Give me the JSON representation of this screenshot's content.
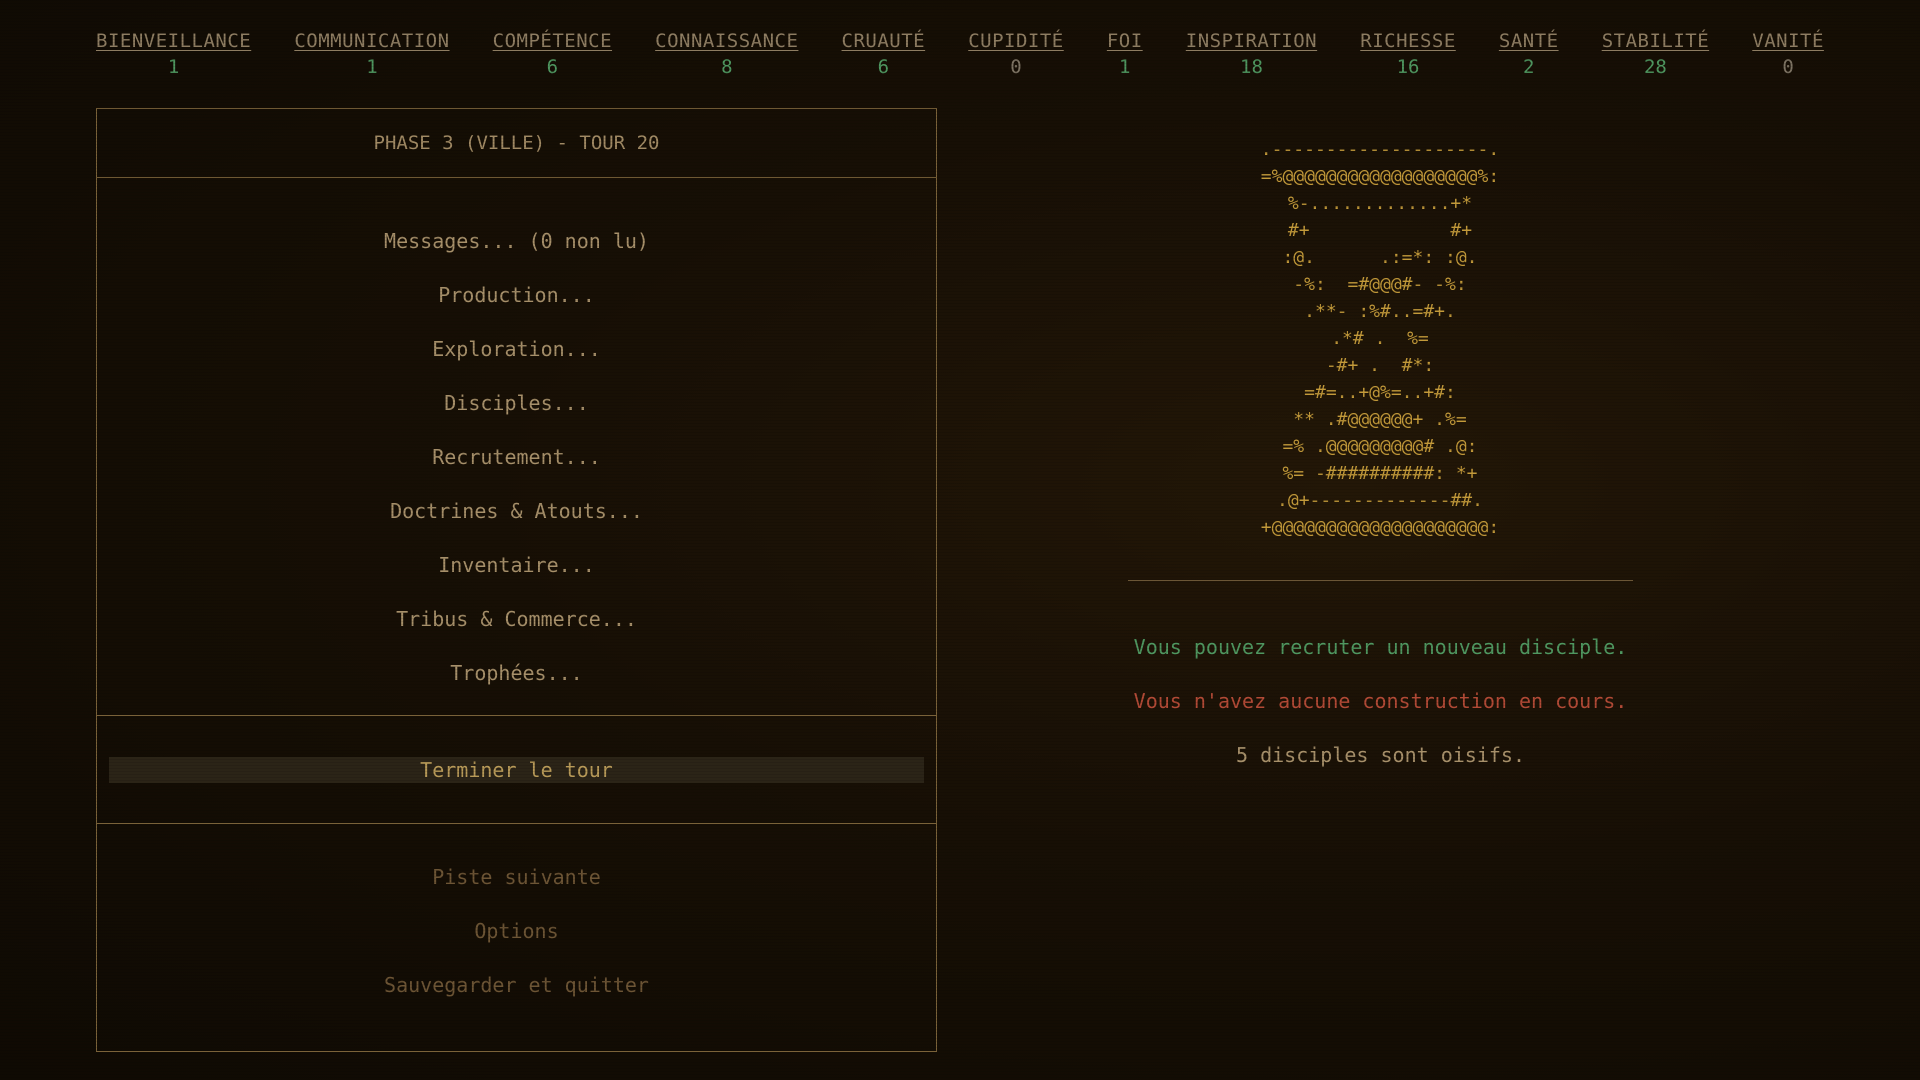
{
  "stats": [
    {
      "name": "BIENVEILLANCE",
      "value": "1"
    },
    {
      "name": "COMMUNICATION",
      "value": "1"
    },
    {
      "name": "COMPÉTENCE",
      "value": "6"
    },
    {
      "name": "CONNAISSANCE",
      "value": "8"
    },
    {
      "name": "CRUAUTÉ",
      "value": "6"
    },
    {
      "name": "CUPIDITÉ",
      "value": "0"
    },
    {
      "name": "FOI",
      "value": "1"
    },
    {
      "name": "INSPIRATION",
      "value": "18"
    },
    {
      "name": "RICHESSE",
      "value": "16"
    },
    {
      "name": "SANTÉ",
      "value": "2"
    },
    {
      "name": "STABILITÉ",
      "value": "28"
    },
    {
      "name": "VANITÉ",
      "value": "0"
    }
  ],
  "panel": {
    "title": "PHASE 3 (VILLE) - TOUR 20",
    "menu": [
      "Messages... (0 non lu)",
      "Production...",
      "Exploration...",
      "Disciples...",
      "Recrutement...",
      "Doctrines & Atouts...",
      "Inventaire...",
      "Tribus & Commerce...",
      "Trophées..."
    ],
    "end_turn": "Terminer le tour",
    "system_menu": [
      "Piste suivante",
      "Options",
      "Sauvegarder et quitter"
    ]
  },
  "ascii_art": [
    ".--------------------.",
    "=%@@@@@@@@@@@@@@@@@@%:",
    "%-.............+*",
    "#+             #+",
    ":@.      .:=*: :@.",
    "-%:  =#@@@#- -%:",
    ".**- :%#..=#+.",
    ".*# .  %=",
    "-#+ .  #*:",
    "=#=..+@%=..+#:",
    "** .#@@@@@@+ .%=",
    "=% .@@@@@@@@@# .@:",
    "%= -##########: *+",
    ".@+-------------##.",
    "+@@@@@@@@@@@@@@@@@@@@:"
  ],
  "messages": [
    {
      "text": "Vous pouvez recruter un nouveau disciple.",
      "tone": "green"
    },
    {
      "text": "Vous n'avez aucune construction en cours.",
      "tone": "red"
    },
    {
      "text": "5 disciples sont oisifs.",
      "tone": "neutral"
    }
  ],
  "colors": {
    "positive": "#4f9760",
    "negative": "#b24a36",
    "accent": "#c39a3a"
  }
}
